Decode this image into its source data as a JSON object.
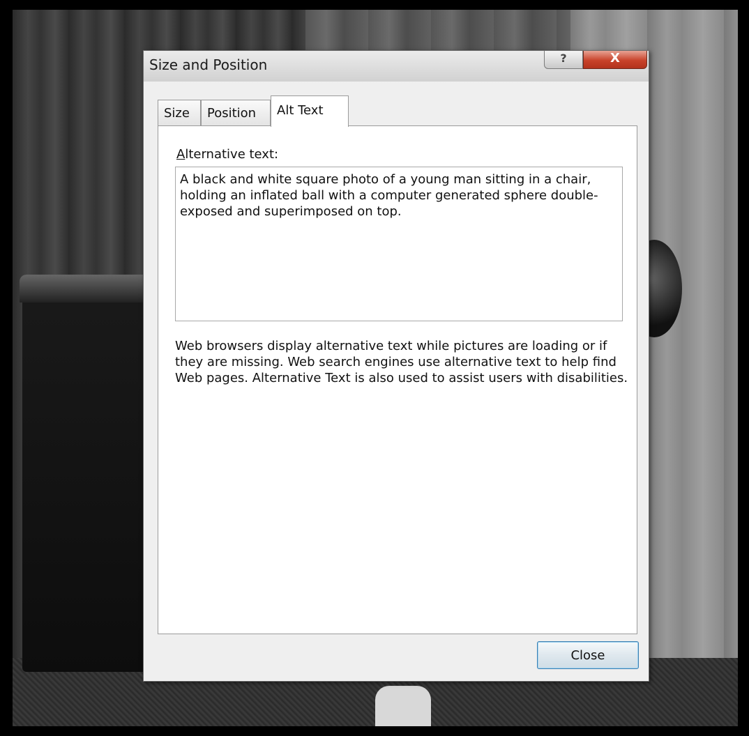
{
  "dialog": {
    "title": "Size and Position",
    "help_label": "?",
    "close_x_label": "X"
  },
  "tabs": [
    {
      "label": "Size",
      "active": false
    },
    {
      "label": "Position",
      "active": false
    },
    {
      "label": "Alt Text",
      "active": true
    }
  ],
  "alt_text": {
    "label_mnemonic": "A",
    "label_rest": "lternative text:",
    "value": "A black and white square photo of a young man sitting in a chair, holding an inflated ball with a computer generated sphere double-exposed and superimposed on top.",
    "help": "Web browsers display alternative text while pictures are loading or if they are missing.  Web search engines use alternative text to help find Web pages.  Alternative Text is also used to assist users with disabilities."
  },
  "footer": {
    "close_label": "Close"
  },
  "colors": {
    "close_x_button": "#c8422a",
    "close_button_border": "#3c7fb1"
  }
}
